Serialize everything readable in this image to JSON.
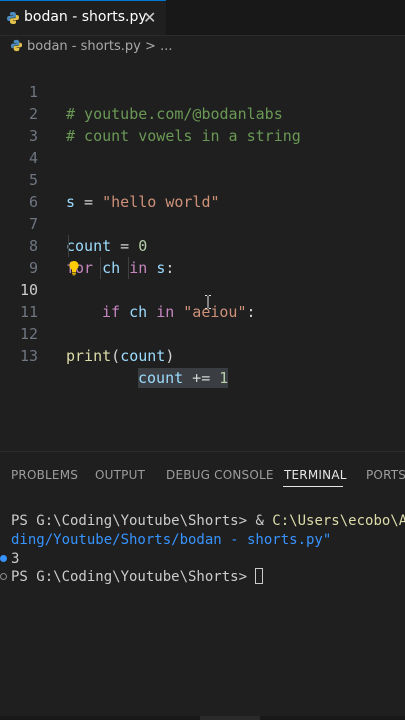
{
  "tab": {
    "label": "bodan - shorts.py",
    "close": "✕"
  },
  "breadcrumb": {
    "file": "bodan - shorts.py",
    "sep": " > ",
    "rest": "..."
  },
  "editor": {
    "active_line": 10,
    "line_numbers": [
      "1",
      "2",
      "3",
      "4",
      "5",
      "6",
      "7",
      "8",
      "9",
      "10",
      "11",
      "12",
      "13"
    ],
    "line1": "# youtube.com/@bodanlabs",
    "line2": "# count vowels in a string",
    "line5": {
      "var": "s",
      "op": " = ",
      "str": "\"hello world\""
    },
    "line7": {
      "var": "count",
      "op": " = ",
      "num": "0"
    },
    "line8": {
      "kw1": "for",
      "var1": "ch",
      "kw2": "in",
      "var2": "s",
      "colon": ":"
    },
    "line9": {
      "kw1": "if",
      "var1": "ch",
      "kw2": "in",
      "str": "\"aeiou\"",
      "colon": ":"
    },
    "line10": {
      "var": "count",
      "op": " += ",
      "num": "1"
    },
    "line12": {
      "fn": "print",
      "open": "(",
      "var": "count",
      "close": ")"
    }
  },
  "panel": {
    "tabs": [
      "PROBLEMS",
      "OUTPUT",
      "DEBUG CONSOLE",
      "TERMINAL",
      "PORTS"
    ],
    "active_tab": "TERMINAL"
  },
  "terminal": {
    "prompt1": "PS G:\\Coding\\Youtube\\Shorts> ",
    "amp": "& ",
    "cmd_path": "C:\\Users\\ecobo\\Ap",
    "cont": "ding/Youtube/Shorts/bodan - shorts.py\"",
    "output": "3",
    "prompt2": "PS G:\\Coding\\Youtube\\Shorts> "
  },
  "colors": {
    "accent": "#0078d4",
    "comment": "#6a9955",
    "keyword": "#c586c0",
    "variable": "#9cdcfe",
    "string": "#ce9178",
    "number": "#b5cea8",
    "function": "#dcdcaa"
  }
}
